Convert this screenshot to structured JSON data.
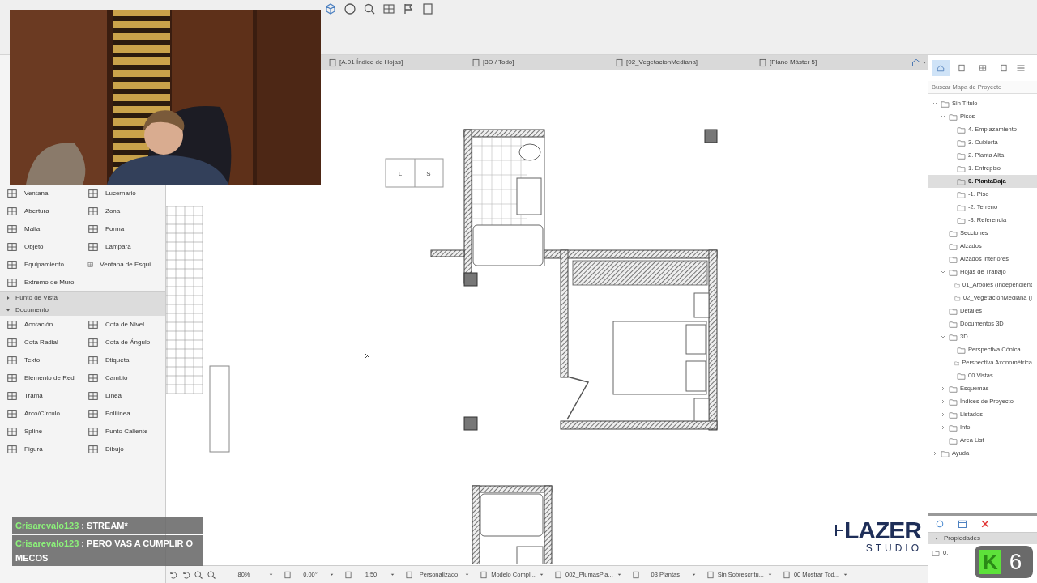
{
  "view_tabs": [
    {
      "label": "[A.01 Índice de Hojas]",
      "selected": false
    },
    {
      "label": "[3D / Todo]",
      "selected": false
    },
    {
      "label": "[02_VegetacionMediana]",
      "selected": false
    },
    {
      "label": "[Plano Máster 5]",
      "selected": false
    }
  ],
  "toolbox": {
    "tools": [
      "Ventana",
      "Lucernario",
      "Abertura",
      "Zona",
      "Malla",
      "Forma",
      "Objeto",
      "Lámpara",
      "Equipamiento",
      "Ventana de Esqui…",
      "Extremo de Muro"
    ],
    "sections": [
      {
        "label": "Punto de Vista",
        "expanded": false
      },
      {
        "label": "Documento",
        "expanded": true,
        "tools": [
          "Acotación",
          "Cota de Nivel",
          "Cota Radial",
          "Cota de Ángulo",
          "Texto",
          "Etiqueta",
          "Elemento de Red",
          "Cambio",
          "Trama",
          "Línea",
          "Arco/Círculo",
          "Polilínea",
          "Spline",
          "Punto Caliente",
          "Figura",
          "Dibujo"
        ]
      }
    ]
  },
  "plan": {
    "labels": [
      "L",
      "S"
    ]
  },
  "map": {
    "tabs": [
      {
        "selected": true
      },
      {
        "selected": false
      },
      {
        "selected": false
      },
      {
        "selected": false
      }
    ],
    "search": {
      "placeholder": "Buscar Mapa de Proyecto"
    },
    "tree": [
      {
        "label": "Sin Título",
        "selected": false,
        "expanded": true,
        "children": [
          {
            "label": "Pisos",
            "selected": false,
            "expanded": true,
            "children": [
              {
                "label": "4. Emplazamiento",
                "selected": false
              },
              {
                "label": "3. Cubierta",
                "selected": false
              },
              {
                "label": "2. Planta Alta",
                "selected": false
              },
              {
                "label": "1. Entrepiso",
                "selected": false
              },
              {
                "label": "0. PlantaBaja",
                "selected": true
              },
              {
                "label": "-1. Piso",
                "selected": false
              },
              {
                "label": "-2. Terreno",
                "selected": false
              },
              {
                "label": "-3. Referencia",
                "selected": false
              }
            ]
          },
          {
            "label": "Secciones",
            "selected": false
          },
          {
            "label": "Alzados",
            "selected": false
          },
          {
            "label": "Alzados Interiores",
            "selected": false
          },
          {
            "label": "Hojas de Trabajo",
            "selected": false,
            "expanded": true,
            "children": [
              {
                "label": "01_Arboles (Independient",
                "selected": false
              },
              {
                "label": "02_VegetacionMediana (I",
                "selected": false
              }
            ]
          },
          {
            "label": "Detalles",
            "selected": false
          },
          {
            "label": "Documentos 3D",
            "selected": false
          },
          {
            "label": "3D",
            "selected": false,
            "expanded": true,
            "children": [
              {
                "label": "Perspectiva Cónica",
                "selected": false
              },
              {
                "label": "Perspectiva Axonométrica",
                "selected": false
              },
              {
                "label": "00 Vistas",
                "selected": false
              }
            ]
          },
          {
            "label": "Esquemas",
            "selected": false,
            "expanded": false
          },
          {
            "label": "Índices de Proyecto",
            "selected": false,
            "expanded": false
          },
          {
            "label": "Listados",
            "selected": false,
            "expanded": false
          },
          {
            "label": "Info",
            "selected": false,
            "expanded": false
          },
          {
            "label": "Area List",
            "selected": false
          }
        ]
      },
      {
        "label": "Ayuda",
        "selected": false,
        "expanded": false
      }
    ]
  },
  "properties": {
    "title": "Propiedades",
    "expanded": true,
    "field": "0."
  },
  "status_bar": [
    "80%",
    "0,00°",
    "1:50",
    "Personalizado",
    "Modelo Compl...",
    "002_PlumasPla...",
    "03 Plantas",
    "Sin Sobrescritu...",
    "00 Mostrar Tod..."
  ],
  "chat": [
    {
      "user": "Crisarevalo123",
      "text": ": STREAM*"
    },
    {
      "user": "Crisarevalo123",
      "text": ": PERO VAS A CUMPLIR O MECOS"
    }
  ],
  "logo": {
    "name": "LAZER",
    "subtitle": "STUDIO"
  },
  "channel_badge": {
    "letter": "K",
    "number": "6"
  }
}
